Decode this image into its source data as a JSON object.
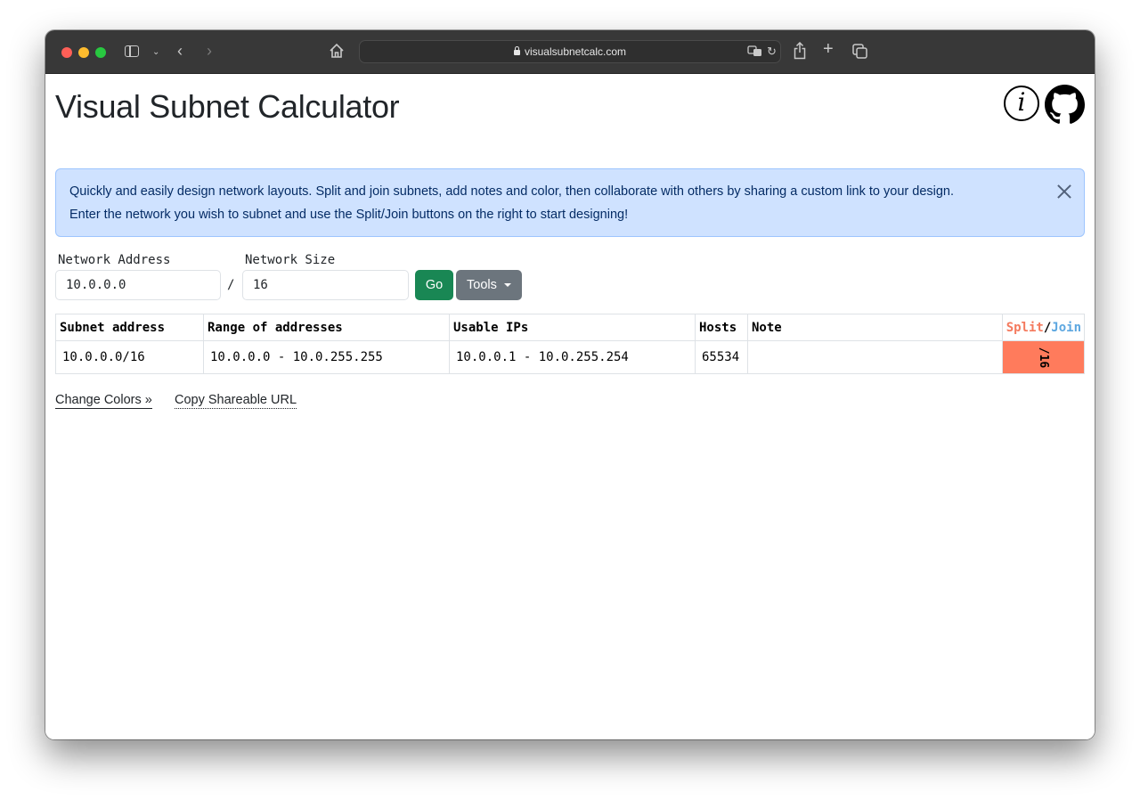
{
  "browser": {
    "url": "visualsubnetcalc.com",
    "icons": [
      "sidebar-icon",
      "chevron-down-icon",
      "back-icon",
      "forward-icon",
      "home-icon",
      "lock-icon",
      "translate-icon",
      "reload-icon",
      "share-icon",
      "new-tab-icon",
      "tabs-overview-icon"
    ]
  },
  "header": {
    "title": "Visual Subnet Calculator",
    "info_icon_glyph": "i"
  },
  "alert": {
    "line1": "Quickly and easily design network layouts. Split and join subnets, add notes and color, then collaborate with others by sharing a custom link to your design.",
    "line2": "Enter the network you wish to subnet and use the Split/Join buttons on the right to start designing!"
  },
  "form": {
    "network_address_label": "Network Address",
    "network_address_value": "10.0.0.0",
    "separator": "/",
    "network_size_label": "Network Size",
    "network_size_value": "16",
    "go_label": "Go",
    "tools_label": "Tools"
  },
  "table": {
    "headers": {
      "subnet": "Subnet address",
      "range": "Range of addresses",
      "usable": "Usable IPs",
      "hosts": "Hosts",
      "note": "Note",
      "split": "Split",
      "split_join_sep": "/",
      "join": "Join"
    },
    "rows": [
      {
        "subnet": "10.0.0.0/16",
        "range": "10.0.0.0 - 10.0.255.255",
        "usable": "10.0.0.1 - 10.0.255.254",
        "hosts": "65534",
        "note": "",
        "split_button": "/16",
        "color": "#ff7b5c"
      }
    ]
  },
  "footer_links": {
    "change_colors": "Change Colors »",
    "copy_url": "Copy Shareable URL"
  }
}
